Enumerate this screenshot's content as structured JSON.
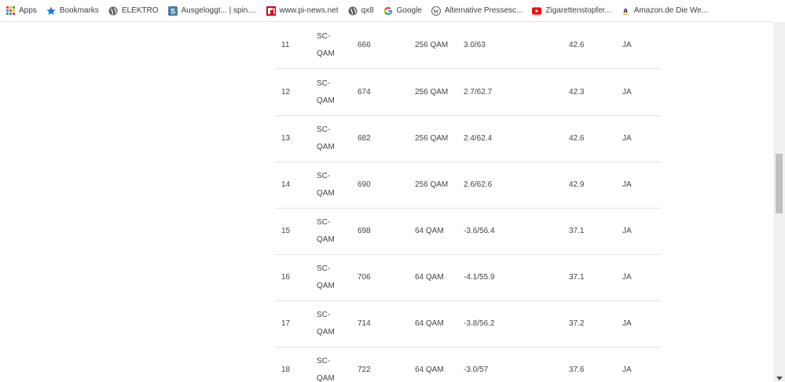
{
  "bookmarks": [
    {
      "label": "Apps",
      "icon": "apps-grid-icon"
    },
    {
      "label": "Bookmarks",
      "icon": "star-icon"
    },
    {
      "label": "ELEKTRO",
      "icon": "globe-icon"
    },
    {
      "label": "Ausgeloggt... | spin....",
      "icon": "s-site-icon"
    },
    {
      "label": "www.pi-news.net",
      "icon": "pi-site-icon"
    },
    {
      "label": "qx8",
      "icon": "globe-icon"
    },
    {
      "label": "Google",
      "icon": "google-icon"
    },
    {
      "label": "Alternative Pressesc...",
      "icon": "wordpress-icon"
    },
    {
      "label": "Zigarettenstopfer...",
      "icon": "youtube-icon"
    },
    {
      "label": "Amazon.de Die We...",
      "icon": "amazon-icon"
    }
  ],
  "table": {
    "rows": [
      {
        "num": "11",
        "type_line1": "SC-",
        "type_line2": "QAM",
        "freq": "666",
        "mod": "256 QAM",
        "level": "3.0/63",
        "snr": "42.6",
        "lock": "JA"
      },
      {
        "num": "12",
        "type_line1": "SC-",
        "type_line2": "QAM",
        "freq": "674",
        "mod": "256 QAM",
        "level": "2.7/62.7",
        "snr": "42.3",
        "lock": "JA"
      },
      {
        "num": "13",
        "type_line1": "SC-",
        "type_line2": "QAM",
        "freq": "682",
        "mod": "256 QAM",
        "level": "2.4/62.4",
        "snr": "42.6",
        "lock": "JA"
      },
      {
        "num": "14",
        "type_line1": "SC-",
        "type_line2": "QAM",
        "freq": "690",
        "mod": "256 QAM",
        "level": "2.6/62.6",
        "snr": "42.9",
        "lock": "JA"
      },
      {
        "num": "15",
        "type_line1": "SC-",
        "type_line2": "QAM",
        "freq": "698",
        "mod": "64 QAM",
        "level": "-3.6/56.4",
        "snr": "37.1",
        "lock": "JA"
      },
      {
        "num": "16",
        "type_line1": "SC-",
        "type_line2": "QAM",
        "freq": "706",
        "mod": "64 QAM",
        "level": "-4.1/55.9",
        "snr": "37.1",
        "lock": "JA"
      },
      {
        "num": "17",
        "type_line1": "SC-",
        "type_line2": "QAM",
        "freq": "714",
        "mod": "64 QAM",
        "level": "-3.8/56.2",
        "snr": "37.2",
        "lock": "JA"
      },
      {
        "num": "18",
        "type_line1": "SC-",
        "type_line2": "QAM",
        "freq": "722",
        "mod": "64 QAM",
        "level": "-3.0/57",
        "snr": "37.6",
        "lock": "JA"
      }
    ]
  }
}
